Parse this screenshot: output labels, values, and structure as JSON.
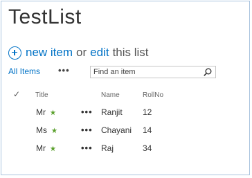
{
  "list": {
    "title": "TestList"
  },
  "commands": {
    "new_item": "new item",
    "or": "or",
    "edit": "edit",
    "this_list": "this list"
  },
  "views": {
    "all_items": "All Items",
    "more": "•••"
  },
  "search": {
    "placeholder": "Find an item"
  },
  "table": {
    "headers": {
      "title": "Title",
      "name": "Name",
      "rollno": "RollNo"
    },
    "rows": [
      {
        "title": "Mr",
        "name": "Ranjit",
        "rollno": "12",
        "menu": "•••"
      },
      {
        "title": "Ms",
        "name": "Chayani",
        "rollno": "14",
        "menu": "•••"
      },
      {
        "title": "Mr",
        "name": "Raj",
        "rollno": "34",
        "menu": "•••"
      }
    ]
  },
  "colors": {
    "accent": "#0072c6",
    "new_icon": "#5aa02c",
    "border": "#a9c3de"
  },
  "icons": {
    "add": "circle-plus-icon",
    "search": "magnifier-icon",
    "new": "new-item-star-icon",
    "select": "checkmark-icon"
  }
}
